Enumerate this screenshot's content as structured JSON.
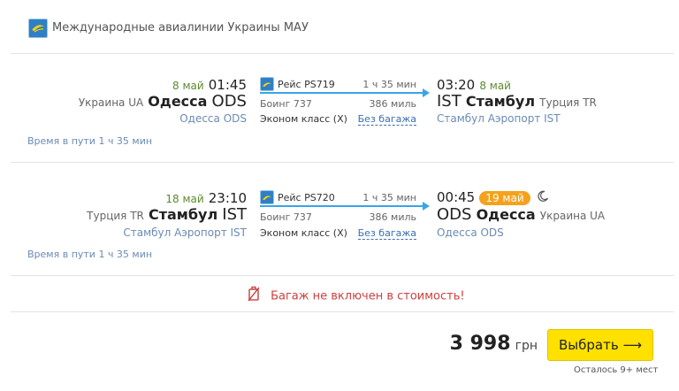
{
  "airline": {
    "name": "Международные авиалинии Украины МАУ",
    "logo_icon": "mau-airline-logo-icon"
  },
  "flights": [
    {
      "dep_date": "8 май",
      "dep_time": "01:45",
      "dep_country": "Украина UA",
      "dep_city": "Одесса",
      "dep_code": "ODS",
      "dep_airport": "Одесса ODS",
      "flight_label": "Рейс PS719",
      "duration": "1 ч 35 мин",
      "aircraft": "Боинг 737",
      "distance": "386 миль",
      "cabin": "Эконом класс (X)",
      "baggage": "Без багажа",
      "arr_time": "03:20",
      "arr_date": "8 май",
      "arr_code": "IST",
      "arr_city": "Стамбул",
      "arr_country": "Турция TR",
      "arr_airport": "Стамбул Аэропорт IST",
      "travel_time": "Время в пути 1 ч 35 мин"
    },
    {
      "dep_date": "18 май",
      "dep_time": "23:10",
      "dep_country": "Турция TR",
      "dep_city": "Стамбул",
      "dep_code": "IST",
      "dep_airport": "Стамбул Аэропорт IST",
      "flight_label": "Рейс PS720",
      "duration": "1 ч 35 мин",
      "aircraft": "Боинг 737",
      "distance": "386 миль",
      "cabin": "Эконом класс (X)",
      "baggage": "Без багажа",
      "arr_time": "00:45",
      "arr_date": "19 май",
      "arr_code": "ODS",
      "arr_city": "Одесса",
      "arr_country": "Украина UA",
      "arr_airport": "Одесса ODS",
      "travel_time": "Время в пути 1 ч 35 мин"
    }
  ],
  "baggage_notice": "Багаж не включен в стоимость!",
  "price": {
    "amount": "3 998",
    "currency": "грн"
  },
  "select_button": "Выбрать ⟶",
  "seats_left": "Осталось 9+ мест",
  "colors": {
    "accent_yellow": "#ffe100",
    "arrow_blue": "#39a5e8",
    "date_green": "#5b8a2e",
    "next_day_orange": "#f4a21d",
    "warning_red": "#d04040"
  }
}
